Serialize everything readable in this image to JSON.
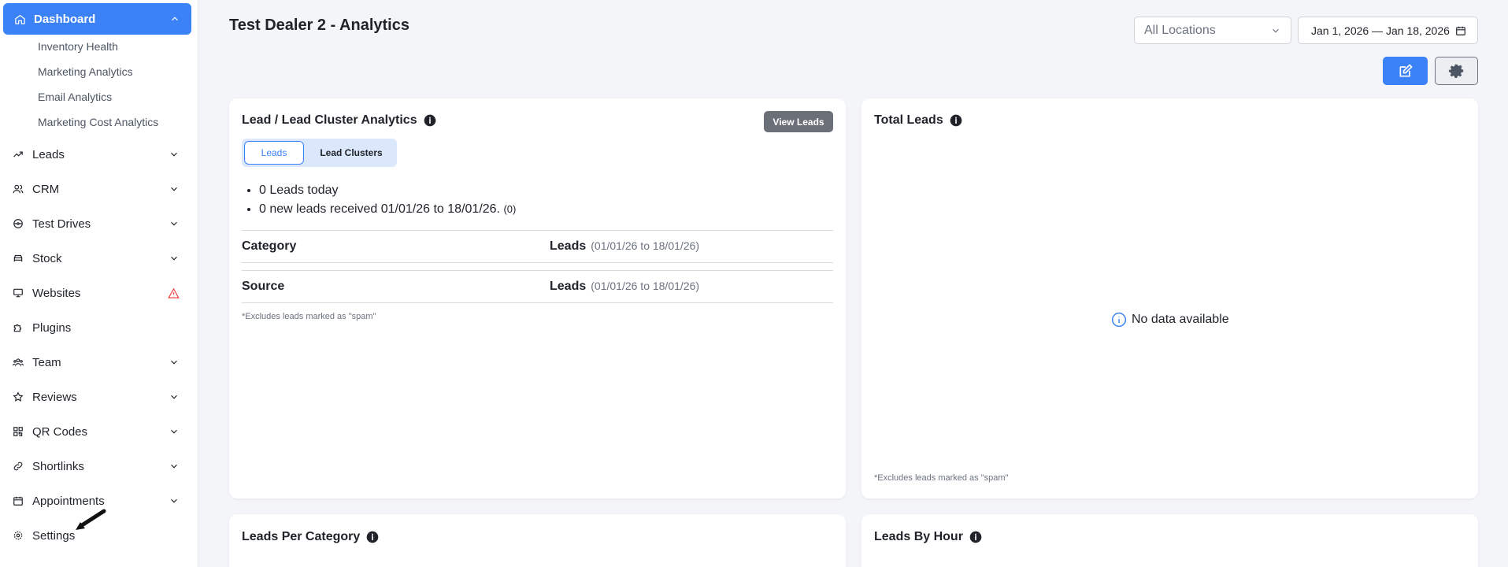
{
  "sidebar": {
    "active": {
      "label": "Dashboard",
      "icon": "home-icon"
    },
    "sub_items": [
      "Inventory Health",
      "Marketing Analytics",
      "Email Analytics",
      "Marketing Cost Analytics"
    ],
    "items": [
      {
        "label": "Leads",
        "icon": "trending-up-icon"
      },
      {
        "label": "CRM",
        "icon": "users-icon"
      },
      {
        "label": "Test Drives",
        "icon": "steering-wheel-icon"
      },
      {
        "label": "Stock",
        "icon": "car-icon"
      },
      {
        "label": "Websites",
        "icon": "monitor-icon"
      },
      {
        "label": "Plugins",
        "icon": "puzzle-icon"
      },
      {
        "label": "Team",
        "icon": "team-icon"
      },
      {
        "label": "Reviews",
        "icon": "star-icon"
      },
      {
        "label": "QR Codes",
        "icon": "qr-code-icon"
      },
      {
        "label": "Shortlinks",
        "icon": "link-icon"
      },
      {
        "label": "Appointments",
        "icon": "calendar-icon"
      },
      {
        "label": "Settings",
        "icon": "gear-icon"
      }
    ]
  },
  "header": {
    "title": "Test Dealer 2 - Analytics",
    "location_select": "All Locations",
    "date_range": "Jan 1, 2026 — Jan 18, 2026"
  },
  "lead_card": {
    "title": "Lead / Lead Cluster Analytics",
    "view_leads": "View Leads",
    "tabs": [
      "Leads",
      "Lead Clusters"
    ],
    "bullet_today": "0 Leads today",
    "bullet_range": "0 new leads received 01/01/26 to 18/01/26.",
    "bullet_range_count": "(0)",
    "category_header": "Category",
    "source_header": "Source",
    "leads_header": "Leads",
    "range_label": "(01/01/26 to 18/01/26)",
    "note": "*Excludes leads marked as \"spam\""
  },
  "total_card": {
    "title": "Total Leads",
    "no_data": "No data available",
    "note": "*Excludes leads marked as \"spam\""
  },
  "bottom_cards": {
    "per_category": "Leads Per Category",
    "by_hour": "Leads By Hour"
  },
  "colors": {
    "primary": "#3b82f6",
    "alert": "#ef4444"
  }
}
